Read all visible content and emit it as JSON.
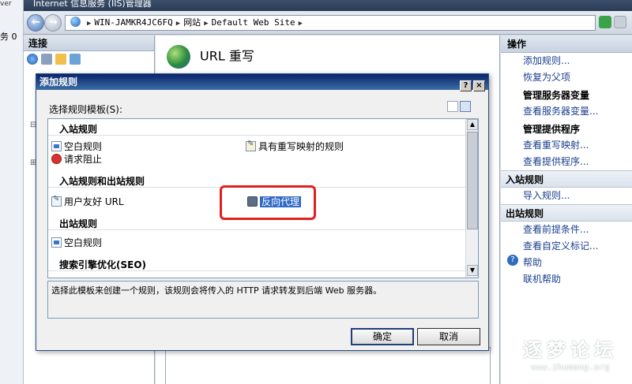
{
  "window": {
    "title": "Internet 信息服务 (IIS)管理器",
    "left_fragment_top": "ver",
    "left_fragment_mid": "务 0"
  },
  "address": {
    "path": [
      "WIN-JAMKR4JC6FQ",
      "网站",
      "Default Web Site"
    ]
  },
  "connections": {
    "header": "连接"
  },
  "main": {
    "feature_title": "URL 重写"
  },
  "actions": {
    "header": "操作",
    "links_top": [
      "添加规则...",
      "恢复为父项"
    ],
    "group_server_vars": "管理服务器变量",
    "view_server_vars": "查看服务器变量...",
    "group_providers": "管理提供程序",
    "links_providers": [
      "查看重写映射...",
      "查看提供程序..."
    ],
    "section_inbound": "入站规则",
    "import_rules": "导入规则...",
    "section_outbound": "出站规则",
    "links_outbound": [
      "查看前提条件...",
      "查看自定义标记..."
    ],
    "help": "帮助",
    "online_help": "联机帮助"
  },
  "dialog": {
    "title": "添加规则",
    "help_btn": "?",
    "close_btn": "×",
    "select_label": "选择规则模板(S):",
    "groups": {
      "inbound": "入站规则",
      "inbound_outbound": "入站规则和出站规则",
      "outbound": "出站规则",
      "seo": "搜索引擎优化(SEO)"
    },
    "items": {
      "blank_rule": "空白规则",
      "rule_with_map": "具有重写映射的规则",
      "request_block": "请求阻止",
      "user_friendly_url": "用户友好 URL",
      "reverse_proxy": "反向代理",
      "outbound_blank_rule": "空白规则"
    },
    "description": "选择此模板来创建一个规则，该规则会将传入的 HTTP 请求转发到后端 Web 服务器。",
    "ok": "确定",
    "cancel": "取消"
  },
  "watermark": {
    "title": "逐梦论坛",
    "url": "www.zhumeng.org"
  },
  "colors": {
    "selection": "#316ac5",
    "highlight_box": "#e02020",
    "dialog_title": "#0a246a"
  }
}
